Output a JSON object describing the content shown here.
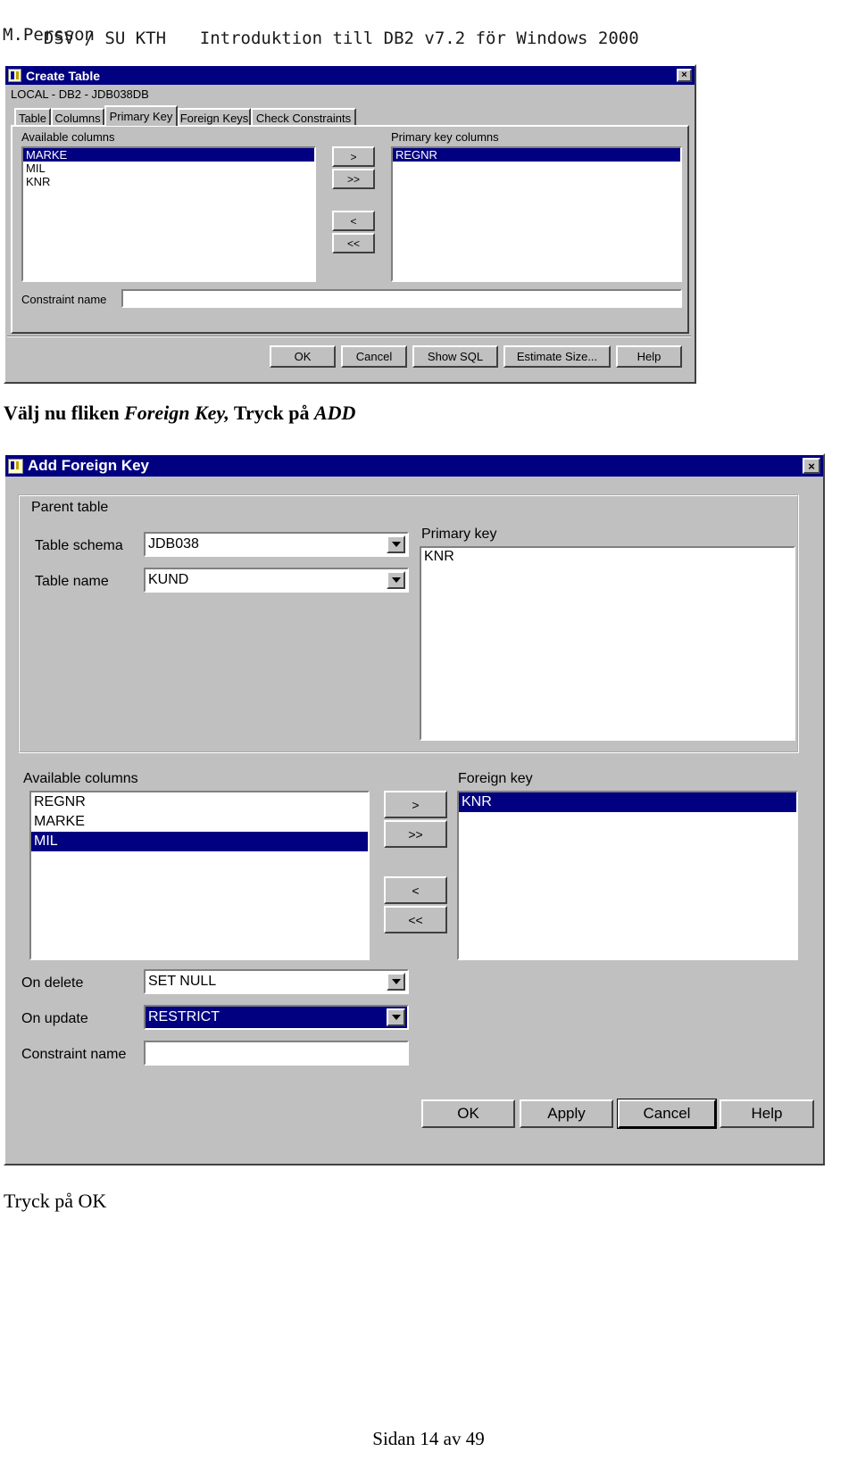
{
  "page_header": {
    "left": "DSV / SU KTH",
    "title": "Introduktion till DB2 v7.2 för Windows 2000",
    "author": "M.Persson"
  },
  "create_table_dialog": {
    "title": "Create Table",
    "close_label": "×",
    "subtitle": "LOCAL - DB2 - JDB038DB",
    "tabs": [
      {
        "label": "Table",
        "active": false
      },
      {
        "label": "Columns",
        "active": false
      },
      {
        "label": "Primary Key",
        "active": true
      },
      {
        "label": "Foreign Keys",
        "active": false
      },
      {
        "label": "Check Constraints",
        "active": false
      }
    ],
    "available_label": "Available columns",
    "available_items": [
      {
        "label": "MARKE",
        "selected": true
      },
      {
        "label": "MIL",
        "selected": false
      },
      {
        "label": "KNR",
        "selected": false
      }
    ],
    "transfer_buttons": [
      ">",
      ">>",
      "<",
      "<<"
    ],
    "primary_label": "Primary key columns",
    "primary_items": [
      {
        "label": "REGNR",
        "selected": true
      }
    ],
    "constraint_label": "Constraint name",
    "constraint_value": "",
    "buttons": [
      {
        "label": "OK",
        "focus": false
      },
      {
        "label": "Cancel",
        "focus": false
      },
      {
        "label": "Show SQL",
        "focus": false
      },
      {
        "label": "Estimate Size...",
        "focus": false
      },
      {
        "label": "Help",
        "focus": false
      }
    ]
  },
  "instruction_1": {
    "part1": "Välj nu fliken ",
    "part2": "Foreign Key,",
    "part3": " Tryck på ",
    "part4": "ADD"
  },
  "add_fk_dialog": {
    "title": "Add Foreign Key",
    "close_label": "×",
    "parent_group_label": "Parent table",
    "schema_label": "Table schema",
    "schema_value": "JDB038",
    "table_label": "Table name",
    "table_value": "KUND",
    "primary_key_label": "Primary key",
    "primary_key_items": [
      {
        "label": "KNR",
        "selected": false
      }
    ],
    "available_label": "Available columns",
    "available_items": [
      {
        "label": "REGNR",
        "selected": false
      },
      {
        "label": "MARKE",
        "selected": false
      },
      {
        "label": "MIL",
        "selected": true
      }
    ],
    "transfer_buttons": [
      ">",
      ">>",
      "<",
      "<<"
    ],
    "foreign_key_label": "Foreign key",
    "foreign_key_items": [
      {
        "label": "KNR",
        "selected": true
      }
    ],
    "on_delete_label": "On delete",
    "on_delete_value": "SET NULL",
    "on_update_label": "On update",
    "on_update_value": "RESTRICT",
    "constraint_label": "Constraint name",
    "constraint_value": "",
    "buttons": [
      {
        "label": "OK",
        "focus": false
      },
      {
        "label": "Apply",
        "focus": false
      },
      {
        "label": "Cancel",
        "focus": true
      },
      {
        "label": "Help",
        "focus": false
      }
    ]
  },
  "instruction_2": "Tryck på OK",
  "footer": "Sidan 14 av 49",
  "colors": {
    "selection": "#000080",
    "face": "#c0c0c0",
    "titlebar": "#000080"
  }
}
